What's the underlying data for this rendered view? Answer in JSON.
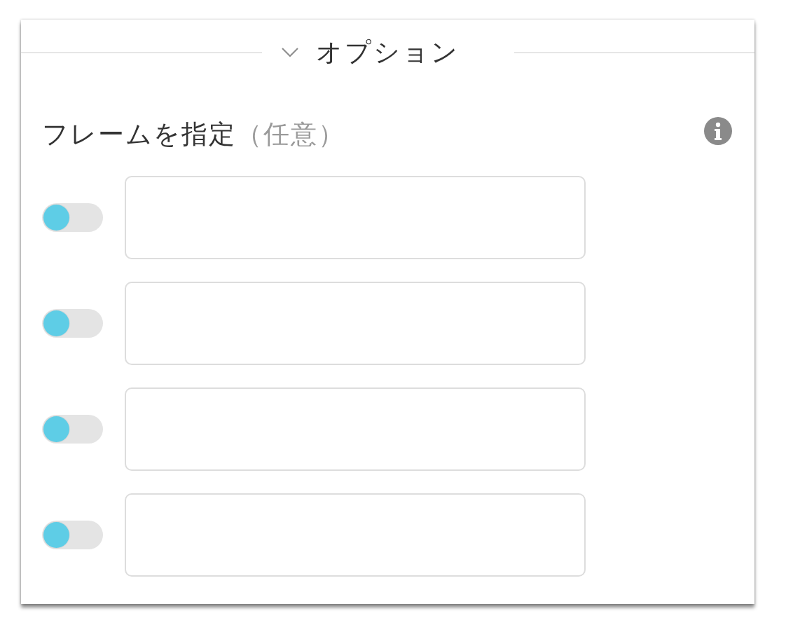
{
  "panel": {
    "section": {
      "title": "オプション",
      "expanded": true
    },
    "field": {
      "label": "フレームを指定",
      "hint": "（任意）"
    },
    "rows": [
      {
        "on": false
      },
      {
        "on": false
      },
      {
        "on": false
      },
      {
        "on": false
      }
    ]
  }
}
